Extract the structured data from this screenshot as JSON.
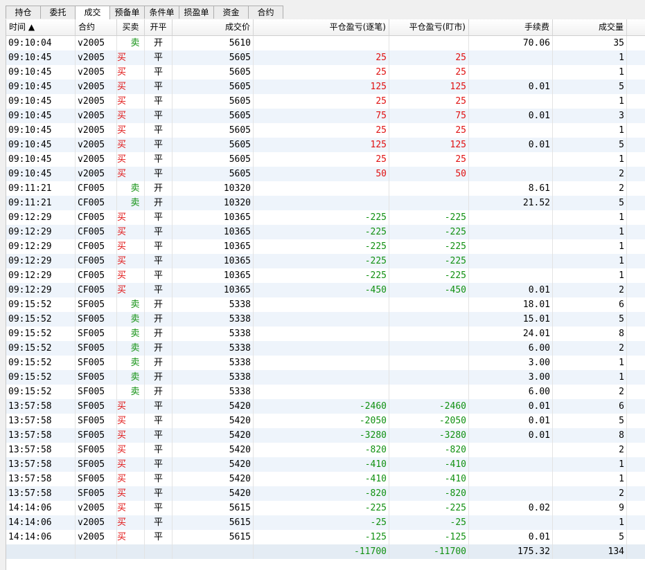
{
  "tabs": [
    {
      "label": "持仓",
      "width": 49
    },
    {
      "label": "委托",
      "width": 49
    },
    {
      "label": "成交",
      "width": 49,
      "active": true
    },
    {
      "label": "预备单",
      "width": 49
    },
    {
      "label": "条件单",
      "width": 49
    },
    {
      "label": "损盈单",
      "width": 49
    },
    {
      "label": "资金",
      "width": 49
    },
    {
      "label": "合约",
      "width": 49
    }
  ],
  "columns": [
    {
      "key": "time",
      "label": "时间 ▲",
      "align": "left"
    },
    {
      "key": "contract",
      "label": "合约",
      "align": "left"
    },
    {
      "key": "side",
      "label": "买卖",
      "align": "center"
    },
    {
      "key": "offset",
      "label": "开平",
      "align": "center"
    },
    {
      "key": "price",
      "label": "成交价",
      "align": "right"
    },
    {
      "key": "pl_trade",
      "label": "平仓盈亏(逐笔)",
      "align": "right"
    },
    {
      "key": "pl_mtm",
      "label": "平仓盈亏(盯市)",
      "align": "right"
    },
    {
      "key": "fee",
      "label": "手续费",
      "align": "right"
    },
    {
      "key": "qty",
      "label": "成交量",
      "align": "right"
    }
  ],
  "colors": {
    "buy": "#e01010",
    "sell": "#109010",
    "loss": "#109010",
    "profit": "#e01010"
  },
  "rows": [
    [
      "09:10:04",
      "v2005",
      "卖",
      "开",
      "5610",
      "",
      "",
      "70.06",
      "35"
    ],
    [
      "09:10:45",
      "v2005",
      "买",
      "平",
      "5605",
      "25",
      "25",
      "",
      "1"
    ],
    [
      "09:10:45",
      "v2005",
      "买",
      "平",
      "5605",
      "25",
      "25",
      "",
      "1"
    ],
    [
      "09:10:45",
      "v2005",
      "买",
      "平",
      "5605",
      "125",
      "125",
      "0.01",
      "5"
    ],
    [
      "09:10:45",
      "v2005",
      "买",
      "平",
      "5605",
      "25",
      "25",
      "",
      "1"
    ],
    [
      "09:10:45",
      "v2005",
      "买",
      "平",
      "5605",
      "75",
      "75",
      "0.01",
      "3"
    ],
    [
      "09:10:45",
      "v2005",
      "买",
      "平",
      "5605",
      "25",
      "25",
      "",
      "1"
    ],
    [
      "09:10:45",
      "v2005",
      "买",
      "平",
      "5605",
      "125",
      "125",
      "0.01",
      "5"
    ],
    [
      "09:10:45",
      "v2005",
      "买",
      "平",
      "5605",
      "25",
      "25",
      "",
      "1"
    ],
    [
      "09:10:45",
      "v2005",
      "买",
      "平",
      "5605",
      "50",
      "50",
      "",
      "2"
    ],
    [
      "09:11:21",
      "CF005",
      "卖",
      "开",
      "10320",
      "",
      "",
      "8.61",
      "2"
    ],
    [
      "09:11:21",
      "CF005",
      "卖",
      "开",
      "10320",
      "",
      "",
      "21.52",
      "5"
    ],
    [
      "09:12:29",
      "CF005",
      "买",
      "平",
      "10365",
      "-225",
      "-225",
      "",
      "1"
    ],
    [
      "09:12:29",
      "CF005",
      "买",
      "平",
      "10365",
      "-225",
      "-225",
      "",
      "1"
    ],
    [
      "09:12:29",
      "CF005",
      "买",
      "平",
      "10365",
      "-225",
      "-225",
      "",
      "1"
    ],
    [
      "09:12:29",
      "CF005",
      "买",
      "平",
      "10365",
      "-225",
      "-225",
      "",
      "1"
    ],
    [
      "09:12:29",
      "CF005",
      "买",
      "平",
      "10365",
      "-225",
      "-225",
      "",
      "1"
    ],
    [
      "09:12:29",
      "CF005",
      "买",
      "平",
      "10365",
      "-450",
      "-450",
      "0.01",
      "2"
    ],
    [
      "09:15:52",
      "SF005",
      "卖",
      "开",
      "5338",
      "",
      "",
      "18.01",
      "6"
    ],
    [
      "09:15:52",
      "SF005",
      "卖",
      "开",
      "5338",
      "",
      "",
      "15.01",
      "5"
    ],
    [
      "09:15:52",
      "SF005",
      "卖",
      "开",
      "5338",
      "",
      "",
      "24.01",
      "8"
    ],
    [
      "09:15:52",
      "SF005",
      "卖",
      "开",
      "5338",
      "",
      "",
      "6.00",
      "2"
    ],
    [
      "09:15:52",
      "SF005",
      "卖",
      "开",
      "5338",
      "",
      "",
      "3.00",
      "1"
    ],
    [
      "09:15:52",
      "SF005",
      "卖",
      "开",
      "5338",
      "",
      "",
      "3.00",
      "1"
    ],
    [
      "09:15:52",
      "SF005",
      "卖",
      "开",
      "5338",
      "",
      "",
      "6.00",
      "2"
    ],
    [
      "13:57:58",
      "SF005",
      "买",
      "平",
      "5420",
      "-2460",
      "-2460",
      "0.01",
      "6"
    ],
    [
      "13:57:58",
      "SF005",
      "买",
      "平",
      "5420",
      "-2050",
      "-2050",
      "0.01",
      "5"
    ],
    [
      "13:57:58",
      "SF005",
      "买",
      "平",
      "5420",
      "-3280",
      "-3280",
      "0.01",
      "8"
    ],
    [
      "13:57:58",
      "SF005",
      "买",
      "平",
      "5420",
      "-820",
      "-820",
      "",
      "2"
    ],
    [
      "13:57:58",
      "SF005",
      "买",
      "平",
      "5420",
      "-410",
      "-410",
      "",
      "1"
    ],
    [
      "13:57:58",
      "SF005",
      "买",
      "平",
      "5420",
      "-410",
      "-410",
      "",
      "1"
    ],
    [
      "13:57:58",
      "SF005",
      "买",
      "平",
      "5420",
      "-820",
      "-820",
      "",
      "2"
    ],
    [
      "14:14:06",
      "v2005",
      "买",
      "平",
      "5615",
      "-225",
      "-225",
      "0.02",
      "9"
    ],
    [
      "14:14:06",
      "v2005",
      "买",
      "平",
      "5615",
      "-25",
      "-25",
      "",
      "1"
    ],
    [
      "14:14:06",
      "v2005",
      "买",
      "平",
      "5615",
      "-125",
      "-125",
      "0.01",
      "5"
    ]
  ],
  "total": [
    "",
    "",
    "",
    "",
    "",
    "-11700",
    "-11700",
    "175.32",
    "134"
  ]
}
